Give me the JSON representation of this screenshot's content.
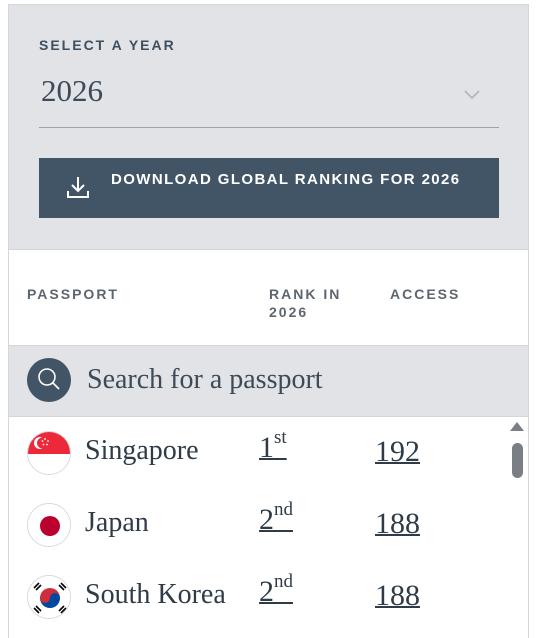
{
  "selector": {
    "label": "SELECT A YEAR",
    "value": "2026",
    "icon": "chevron-down-icon"
  },
  "download": {
    "label": "DOWNLOAD GLOBAL RANKING FOR 2026",
    "icon": "download-icon"
  },
  "table": {
    "headers": {
      "passport": "PASSPORT",
      "rank_line1": "RANK IN",
      "rank_line2": "2026",
      "access": "ACCESS"
    }
  },
  "search": {
    "placeholder": "Search for a passport",
    "icon": "search-icon"
  },
  "rows": [
    {
      "country": "Singapore",
      "rank_num": "1",
      "rank_suffix": "st",
      "access": "192",
      "flag": "singapore-flag-icon"
    },
    {
      "country": "Japan",
      "rank_num": "2",
      "rank_suffix": "nd",
      "access": "188",
      "flag": "japan-flag-icon"
    },
    {
      "country": "South Korea",
      "rank_num": "2",
      "rank_suffix": "nd",
      "access": "188",
      "flag": "south-korea-flag-icon"
    }
  ],
  "colors": {
    "panel_bg": "#e1e3e6",
    "button_bg": "#425567",
    "text_dark": "#2f3b47"
  }
}
